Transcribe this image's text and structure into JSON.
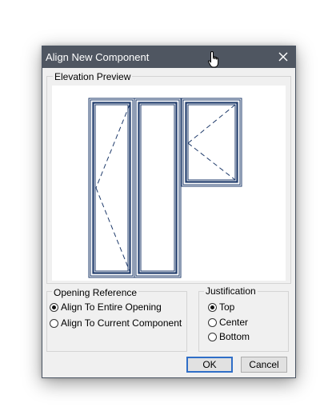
{
  "dialog": {
    "title": "Align New Component",
    "close_symbol": "✕"
  },
  "preview": {
    "legend": "Elevation Preview"
  },
  "opening_reference": {
    "legend": "Opening Reference",
    "options": [
      {
        "label": "Align To Entire Opening",
        "checked": true
      },
      {
        "label": "Align To Current Component",
        "checked": false
      }
    ]
  },
  "justification": {
    "legend": "Justification",
    "options": [
      {
        "label": "Top",
        "checked": true
      },
      {
        "label": "Center",
        "checked": false
      },
      {
        "label": "Bottom",
        "checked": false
      }
    ]
  },
  "buttons": {
    "ok": "OK",
    "cancel": "Cancel"
  },
  "colors": {
    "titlebar": "#4f5661",
    "frame_stroke": "#1f3b6b",
    "default_button_border": "#2f6ec7"
  },
  "icons": {
    "close": "close-icon",
    "cursor": "hand-pointer-icon"
  }
}
